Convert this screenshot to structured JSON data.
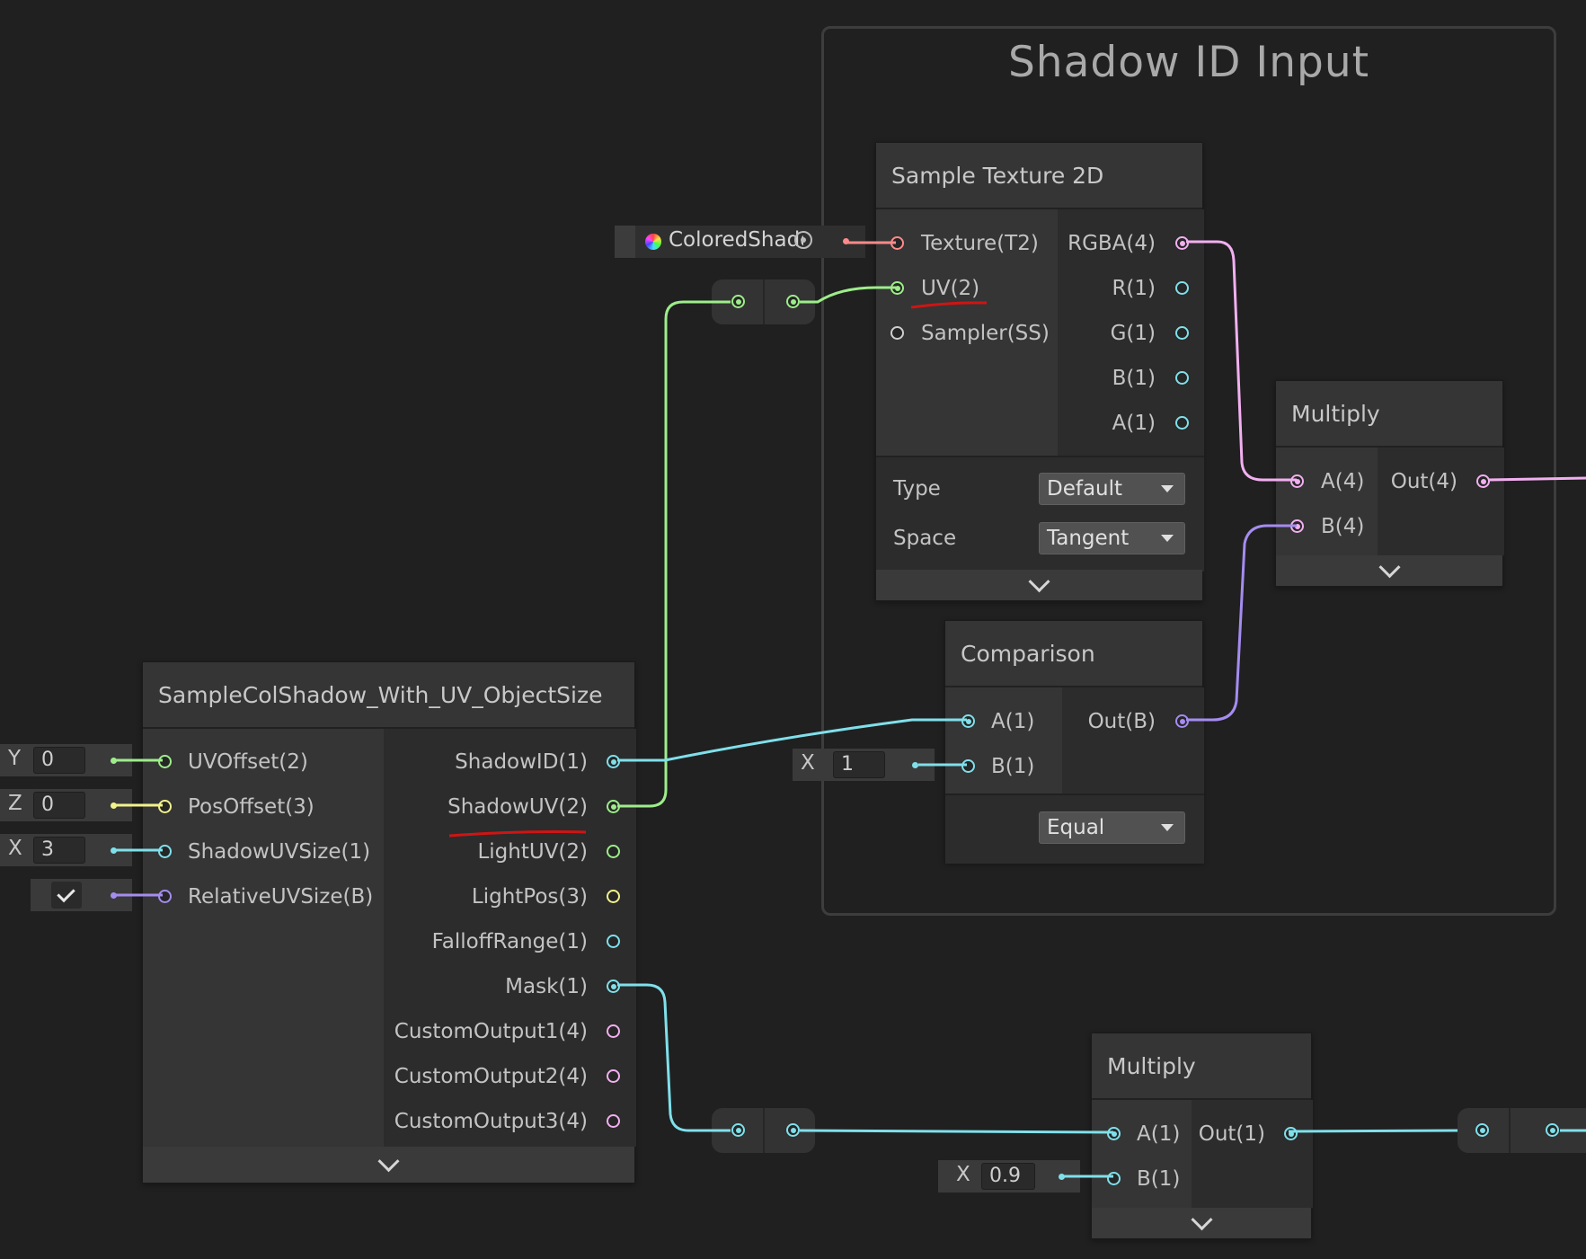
{
  "group": {
    "title": "Shadow ID Input"
  },
  "property_node": {
    "label": "ColoredShadowIDTex",
    "icon": "texture-property-icon"
  },
  "sample_texture": {
    "title": "Sample Texture 2D",
    "inputs": [
      "Texture(T2)",
      "UV(2)",
      "Sampler(SS)"
    ],
    "outputs": [
      "RGBA(4)",
      "R(1)",
      "G(1)",
      "B(1)",
      "A(1)"
    ],
    "type_label": "Type",
    "type_value": "Default",
    "space_label": "Space",
    "space_value": "Tangent"
  },
  "multiply_top": {
    "title": "Multiply",
    "inputs": [
      "A(4)",
      "B(4)"
    ],
    "outputs": [
      "Out(4)"
    ]
  },
  "comparison": {
    "title": "Comparison",
    "inputs": [
      "A(1)",
      "B(1)"
    ],
    "outputs": [
      "Out(B)"
    ],
    "mode_value": "Equal",
    "b_field": {
      "axis": "X",
      "value": "1"
    }
  },
  "subgraph": {
    "title": "SampleColShadow_With_UV_ObjectSize",
    "inputs": [
      "UVOffset(2)",
      "PosOffset(3)",
      "ShadowUVSize(1)",
      "RelativeUVSize(B)"
    ],
    "input_fields": [
      {
        "axis": "Y",
        "value": "0"
      },
      {
        "axis": "Z",
        "value": "0"
      },
      {
        "axis": "X",
        "value": "3"
      }
    ],
    "relative_checked": true,
    "outputs": [
      "ShadowID(1)",
      "ShadowUV(2)",
      "LightUV(2)",
      "LightPos(3)",
      "FalloffRange(1)",
      "Mask(1)",
      "CustomOutput1(4)",
      "CustomOutput2(4)",
      "CustomOutput3(4)"
    ]
  },
  "multiply_bottom": {
    "title": "Multiply",
    "inputs": [
      "A(1)",
      "B(1)"
    ],
    "outputs": [
      "Out(1)"
    ],
    "b_field": {
      "axis": "X",
      "value": "0.9"
    }
  },
  "colors": {
    "float": "#7fe0eb",
    "vector2": "#9ded8a",
    "vector3": "#f2f28c",
    "vector4": "#f2b0f0",
    "boolean": "#a58cf0",
    "texture": "#ff8a8a",
    "annotation": "#d01414"
  }
}
